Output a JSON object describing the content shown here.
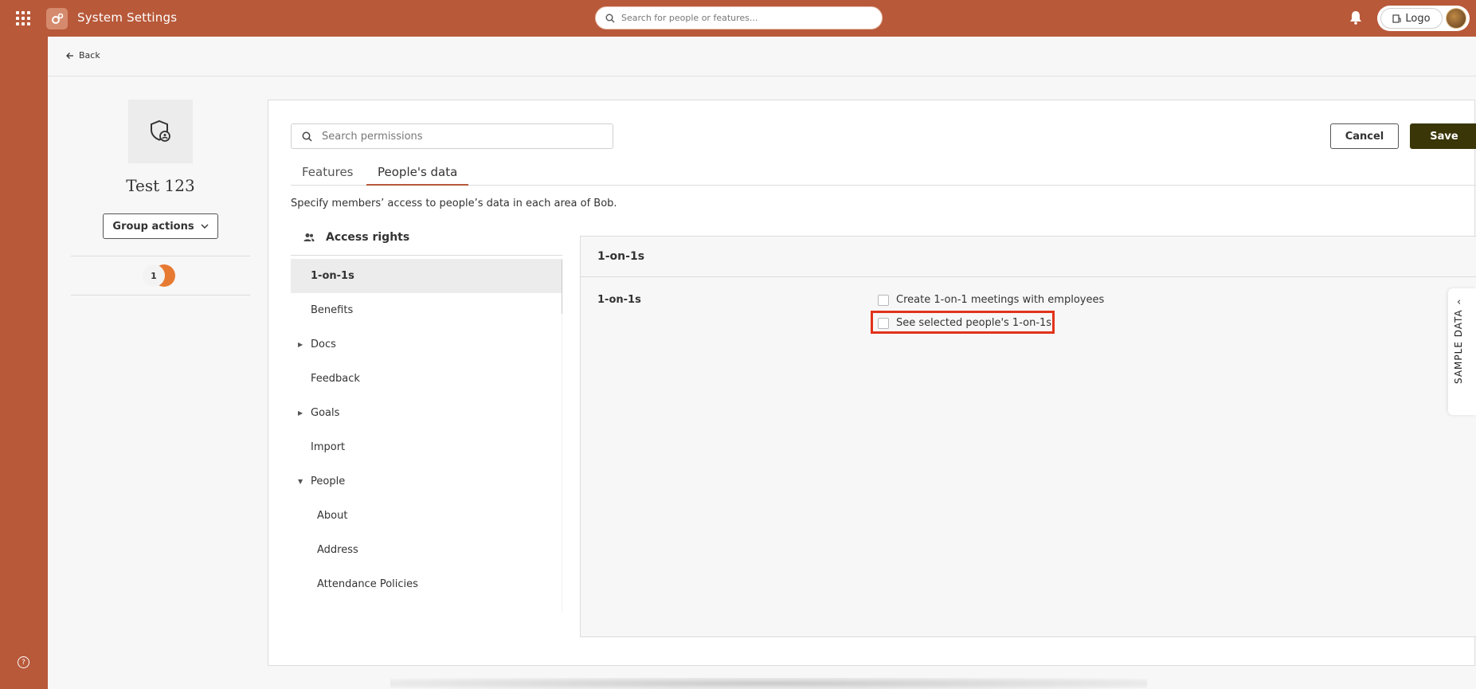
{
  "topbar": {
    "app_title": "System Settings",
    "search_placeholder": "Search for people or features...",
    "logo_label": "Logo"
  },
  "back": {
    "label": "Back"
  },
  "group": {
    "name": "Test 123",
    "actions_label": "Group actions",
    "member_count": "1"
  },
  "toolbar": {
    "search_placeholder": "Search permissions",
    "cancel_label": "Cancel",
    "save_label": "Save"
  },
  "tabs": [
    {
      "label": "Features",
      "active": false
    },
    {
      "label": "People's data",
      "active": true
    }
  ],
  "intro_text": "Specify members’ access to people’s data in each area of Bob.",
  "access_rights": {
    "title": "Access rights",
    "items": [
      {
        "label": "1-on-1s"
      },
      {
        "label": "Benefits"
      },
      {
        "label": "Docs"
      },
      {
        "label": "Feedback"
      },
      {
        "label": "Goals"
      },
      {
        "label": "Import"
      },
      {
        "label": "People"
      },
      {
        "label": "About"
      },
      {
        "label": "Address"
      },
      {
        "label": "Attendance Policies"
      }
    ]
  },
  "detail": {
    "header": "1-on-1s",
    "section_label": "1-on-1s",
    "permissions": [
      {
        "label": "Create 1-on-1 meetings with employees",
        "checked": false
      },
      {
        "label": "See selected people's 1-on-1s",
        "checked": false
      }
    ]
  },
  "side_tab": {
    "label": "SAMPLE DATA"
  },
  "colors": {
    "brand": "#b8593a",
    "save_button": "#3a3608",
    "highlight": "#e2321a",
    "member_avatar": "#e77a32"
  }
}
